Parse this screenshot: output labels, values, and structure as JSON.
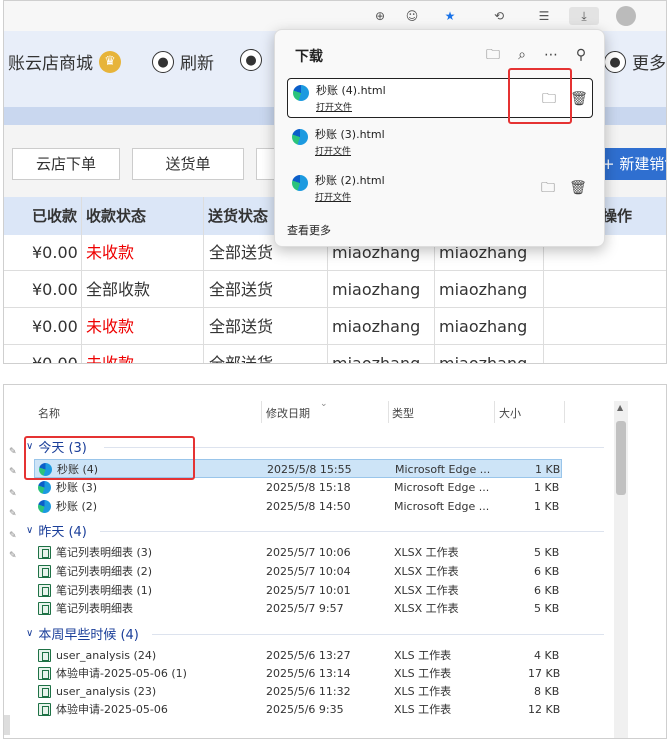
{
  "nav": {
    "items": [
      "账云店商城",
      "刷新",
      "更多"
    ]
  },
  "toolbar": {
    "btn_yundian": "云店下单",
    "btn_songhuo": "送货单",
    "btn_new": "+ 新建销售"
  },
  "table": {
    "headers": [
      "已收款",
      "收款状态",
      "送货状态",
      "",
      "",
      "操作"
    ],
    "rows": [
      [
        "¥0.00",
        "未收款",
        "全部送货",
        "miaozhang",
        "miaozhang"
      ],
      [
        "¥0.00",
        "全部收款",
        "全部送货",
        "miaozhang",
        "miaozhang"
      ],
      [
        "¥0.00",
        "未收款",
        "全部送货",
        "miaozhang",
        "miaozhang"
      ],
      [
        "¥0.00",
        "未收款",
        "全部送货",
        "miaozhang",
        "miaozhang"
      ]
    ]
  },
  "downloads": {
    "title": "下载",
    "items": [
      {
        "name": "秒账 (4).html",
        "action": "打开文件"
      },
      {
        "name": "秒账 (3).html",
        "action": "打开文件"
      },
      {
        "name": "秒账 (2).html",
        "action": "打开文件"
      }
    ],
    "see_more": "查看更多"
  },
  "explorer": {
    "columns": {
      "name": "名称",
      "date": "修改日期",
      "type": "类型",
      "size": "大小"
    },
    "groups": [
      {
        "label": "今天 (3)",
        "files": [
          {
            "name": "秒账 (4)",
            "date": "2025/5/8 15:55",
            "type": "Microsoft Edge ...",
            "size": "1 KB",
            "icon": "edge-icon"
          },
          {
            "name": "秒账 (3)",
            "date": "2025/5/8 15:18",
            "type": "Microsoft Edge ...",
            "size": "1 KB",
            "icon": "edge-icon"
          },
          {
            "name": "秒账 (2)",
            "date": "2025/5/8 14:50",
            "type": "Microsoft Edge ...",
            "size": "1 KB",
            "icon": "edge-icon"
          }
        ]
      },
      {
        "label": "昨天 (4)",
        "files": [
          {
            "name": "笔记列表明细表 (3)",
            "date": "2025/5/7 10:06",
            "type": "XLSX 工作表",
            "size": "5 KB",
            "icon": "excel-icon"
          },
          {
            "name": "笔记列表明细表 (2)",
            "date": "2025/5/7 10:04",
            "type": "XLSX 工作表",
            "size": "6 KB",
            "icon": "excel-icon"
          },
          {
            "name": "笔记列表明细表 (1)",
            "date": "2025/5/7 10:01",
            "type": "XLSX 工作表",
            "size": "6 KB",
            "icon": "excel-icon"
          },
          {
            "name": "笔记列表明细表",
            "date": "2025/5/7 9:57",
            "type": "XLSX 工作表",
            "size": "5 KB",
            "icon": "excel-icon"
          }
        ]
      },
      {
        "label": "本周早些时候 (4)",
        "files": [
          {
            "name": "user_analysis (24)",
            "date": "2025/5/6 13:27",
            "type": "XLS 工作表",
            "size": "4 KB",
            "icon": "excel-icon"
          },
          {
            "name": "体验申请-2025-05-06 (1)",
            "date": "2025/5/6 13:14",
            "type": "XLS 工作表",
            "size": "17 KB",
            "icon": "excel-icon"
          },
          {
            "name": "user_analysis (23)",
            "date": "2025/5/6 11:32",
            "type": "XLS 工作表",
            "size": "8 KB",
            "icon": "excel-icon"
          },
          {
            "name": "体验申请-2025-05-06",
            "date": "2025/5/6 9:35",
            "type": "XLS 工作表",
            "size": "12 KB",
            "icon": "excel-icon"
          }
        ]
      }
    ]
  },
  "colors": {
    "highlight": "#e53333",
    "accent": "#2f6fd0",
    "unpaid": "#ee0000"
  }
}
